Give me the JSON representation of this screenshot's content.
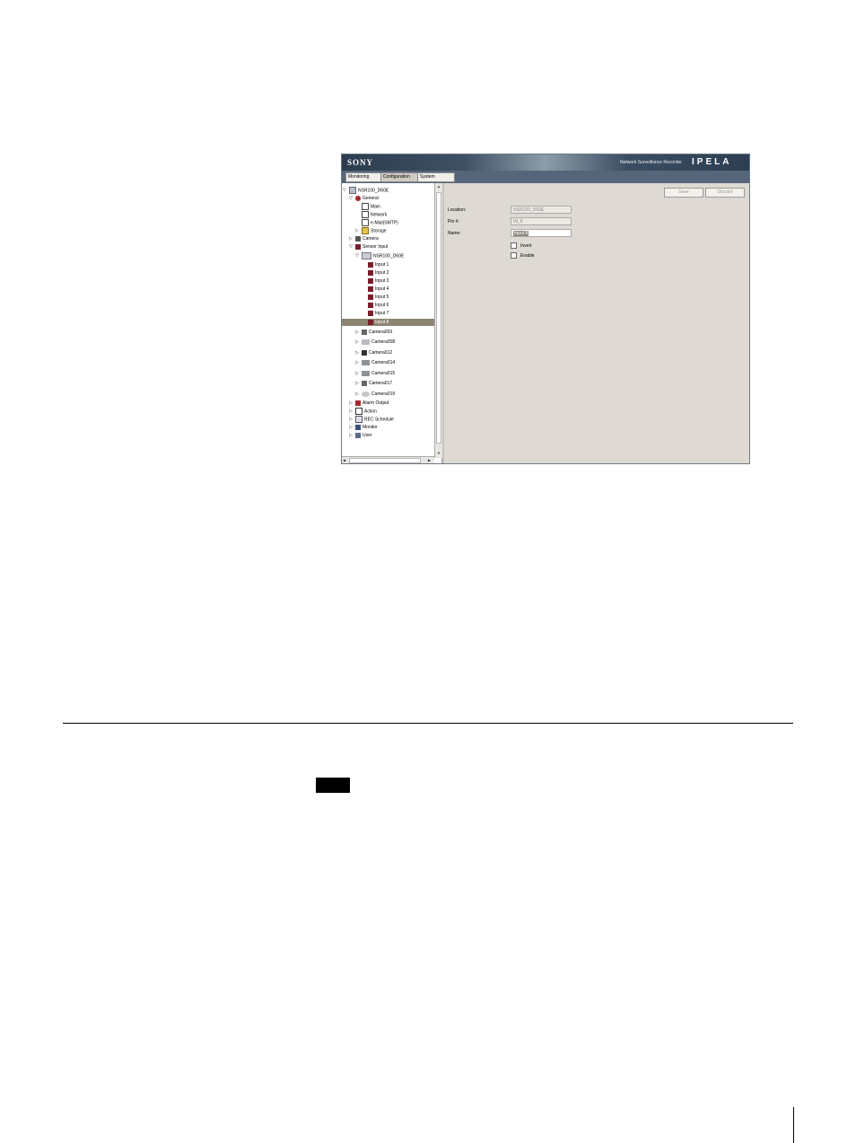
{
  "app": {
    "brand": "SONY",
    "product": "Network Surveillance Recorder",
    "logo": "IPELA",
    "colors": {
      "banner": "#2b3c4f",
      "tabbar": "#56667a",
      "selected": "#8e8473",
      "panel": "#dedad3"
    }
  },
  "tabs": [
    {
      "label": "Monitoring"
    },
    {
      "label": "Configuration",
      "active": true
    },
    {
      "label": "System"
    }
  ],
  "tree": {
    "root": "NSR100_D60E",
    "general": "General",
    "main": "Main",
    "network": "Network",
    "email": "e-Mail(SMTP)",
    "storage": "Storage",
    "camera": "Camera",
    "sensor_input": "Sensor Input",
    "sensor_device": "NSR100_D60E",
    "inputs": [
      "Input 1",
      "Input 2",
      "Input 3",
      "Input 4",
      "Input 5",
      "Input 6",
      "Input 7",
      "Input 8"
    ],
    "cameras": [
      "Camera003",
      "Camera008",
      "Camera012",
      "Camera014",
      "Camera015",
      "Camera017",
      "Camera019"
    ],
    "alarm_output": "Alarm Output",
    "action": "Action",
    "rec_schedule": "REC Schedule",
    "monitor": "Monitor",
    "user": "User"
  },
  "toolbar": {
    "save": "Save",
    "discard": "Discard"
  },
  "form": {
    "location_label": "Location:",
    "location_value": "NSR100_D60E",
    "pin_label": "Pin #:",
    "pin_value": "IN_8",
    "name_label": "Name:",
    "name_value": "Input 8",
    "invert_label": "Invert",
    "enable_label": "Enable"
  }
}
